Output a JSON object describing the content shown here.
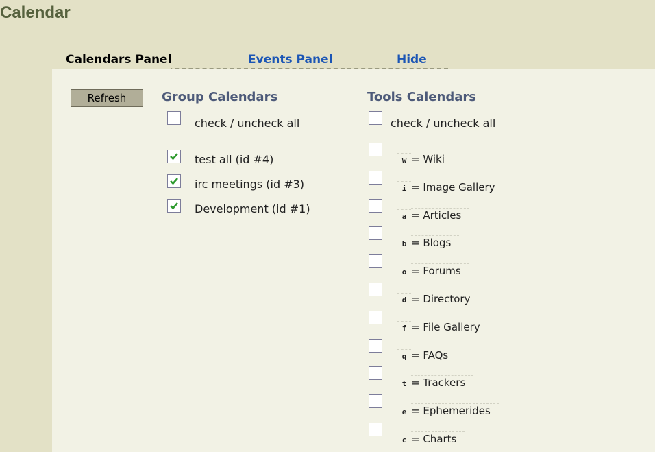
{
  "title": "Calendar",
  "tabs": [
    {
      "label": "Calendars Panel"
    },
    {
      "label": "Events Panel"
    },
    {
      "label": "Hide"
    }
  ],
  "refresh_label": "Refresh",
  "group": {
    "heading": "Group Calendars",
    "check_all_label": "check / uncheck all",
    "check_all": false,
    "items": [
      {
        "label": "test all (id #4)",
        "checked": true
      },
      {
        "label": "irc meetings (id #3)",
        "checked": true
      },
      {
        "label": "Development (id #1)",
        "checked": true
      }
    ]
  },
  "tools": {
    "heading": "Tools Calendars",
    "check_all_label": "check / uncheck all",
    "items": [
      {
        "letter": "w",
        "text": "= Wiki",
        "checked": false
      },
      {
        "letter": "i",
        "text": "= Image Gallery",
        "checked": false
      },
      {
        "letter": "a",
        "text": "= Articles",
        "checked": false
      },
      {
        "letter": "b",
        "text": "= Blogs",
        "checked": false
      },
      {
        "letter": "o",
        "text": "= Forums",
        "checked": false
      },
      {
        "letter": "d",
        "text": "= Directory",
        "checked": false
      },
      {
        "letter": "f",
        "text": "= File Gallery",
        "checked": false
      },
      {
        "letter": "q",
        "text": "= FAQs",
        "checked": false
      },
      {
        "letter": "t",
        "text": "= Trackers",
        "checked": false
      },
      {
        "letter": "e",
        "text": "= Ephemerides",
        "checked": false
      },
      {
        "letter": "c",
        "text": "= Charts",
        "checked": false
      }
    ]
  },
  "colors": {
    "title": "#56613d",
    "heading": "#4d5a79",
    "link": "#1b55b5",
    "checkmark": "#2e9a2e",
    "background": "#e3e1c6",
    "panel": "#f2f2e5"
  }
}
